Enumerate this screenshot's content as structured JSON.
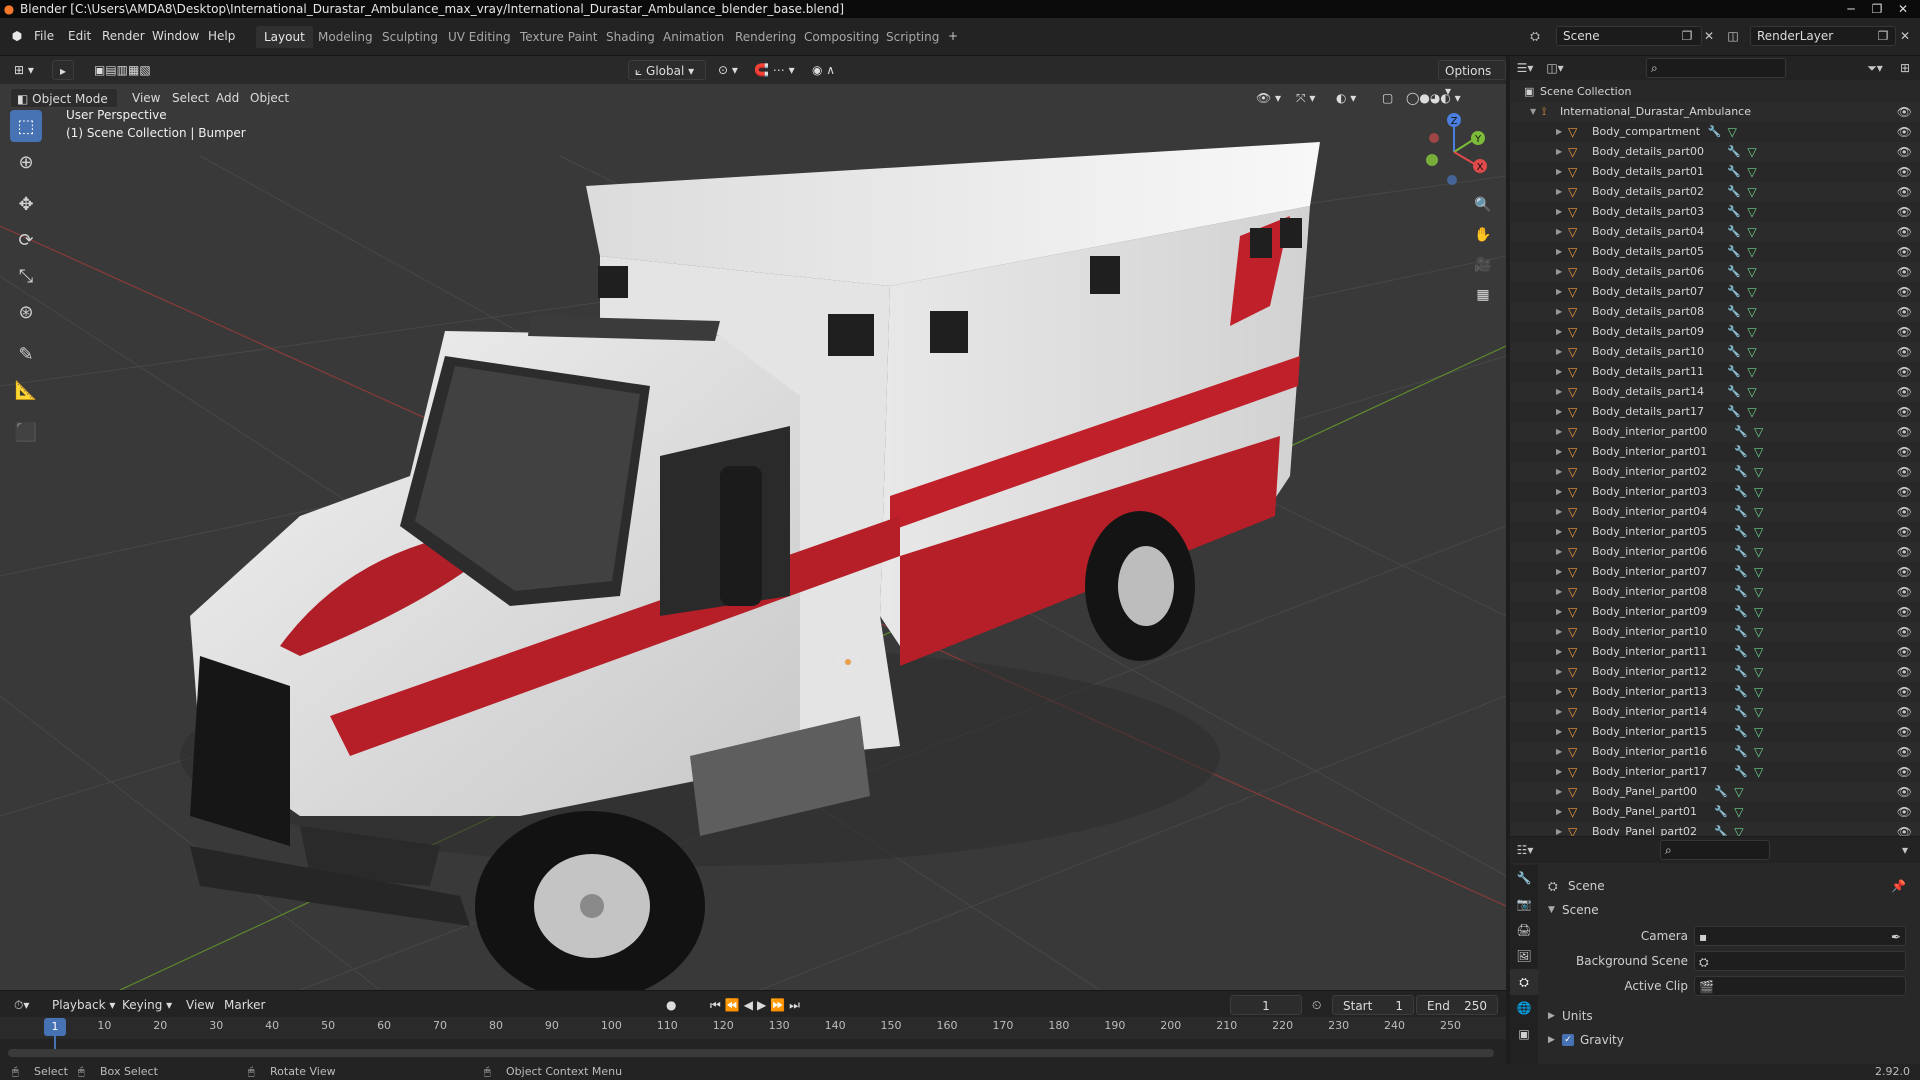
{
  "window": {
    "title": "Blender [C:\\Users\\AMDA8\\Desktop\\International_Durastar_Ambulance_max_vray/International_Durastar_Ambulance_blender_base.blend]"
  },
  "menu": [
    "File",
    "Edit",
    "Render",
    "Window",
    "Help"
  ],
  "workspaces": [
    {
      "label": "Layout",
      "active": true
    },
    {
      "label": "Modeling",
      "active": false
    },
    {
      "label": "Sculpting",
      "active": false
    },
    {
      "label": "UV Editing",
      "active": false
    },
    {
      "label": "Texture Paint",
      "active": false
    },
    {
      "label": "Shading",
      "active": false
    },
    {
      "label": "Animation",
      "active": false
    },
    {
      "label": "Rendering",
      "active": false
    },
    {
      "label": "Compositing",
      "active": false
    },
    {
      "label": "Scripting",
      "active": false
    }
  ],
  "scene_field": "Scene",
  "render_layer_field": "RenderLayer",
  "viewport": {
    "transform_orientation": "Global",
    "options_label": "Options",
    "mode": "Object Mode",
    "header_menus": [
      "View",
      "Select",
      "Add",
      "Object"
    ],
    "perspective_label": "User Perspective",
    "collection_label": "(1) Scene Collection | Bumper",
    "gizmo_axes": {
      "x": "X",
      "y": "Y",
      "z": "Z"
    }
  },
  "outliner": {
    "root": "Scene Collection",
    "collection": "International_Durastar_Ambulance",
    "items": [
      "Body_compartment",
      "Body_details_part00",
      "Body_details_part01",
      "Body_details_part02",
      "Body_details_part03",
      "Body_details_part04",
      "Body_details_part05",
      "Body_details_part06",
      "Body_details_part07",
      "Body_details_part08",
      "Body_details_part09",
      "Body_details_part10",
      "Body_details_part11",
      "Body_details_part14",
      "Body_details_part17",
      "Body_interior_part00",
      "Body_interior_part01",
      "Body_interior_part02",
      "Body_interior_part03",
      "Body_interior_part04",
      "Body_interior_part05",
      "Body_interior_part06",
      "Body_interior_part07",
      "Body_interior_part08",
      "Body_interior_part09",
      "Body_interior_part10",
      "Body_interior_part11",
      "Body_interior_part12",
      "Body_interior_part13",
      "Body_interior_part14",
      "Body_interior_part15",
      "Body_interior_part16",
      "Body_interior_part17",
      "Body_Panel_part00",
      "Body_Panel_part01",
      "Body_Panel_part02"
    ]
  },
  "properties": {
    "context": "Scene",
    "panel_title": "Scene",
    "camera_label": "Camera",
    "background_scene_label": "Background Scene",
    "active_clip_label": "Active Clip",
    "units_label": "Units",
    "gravity_label": "Gravity",
    "gravity_checked": true
  },
  "timeline": {
    "menus": [
      "Playback",
      "Keying",
      "View",
      "Marker"
    ],
    "current_frame": "1",
    "start_label": "Start",
    "start_value": "1",
    "end_label": "End",
    "end_value": "250",
    "ticks": [
      "1",
      "10",
      "20",
      "30",
      "40",
      "50",
      "60",
      "70",
      "80",
      "90",
      "100",
      "110",
      "120",
      "130",
      "140",
      "150",
      "160",
      "170",
      "180",
      "190",
      "200",
      "210",
      "220",
      "230",
      "240",
      "250"
    ]
  },
  "statusbar": {
    "select": "Select",
    "box_select": "Box Select",
    "rotate_view": "Rotate View",
    "context_menu": "Object Context Menu",
    "version": "2.92.0"
  },
  "colors": {
    "accent": "#4772b3",
    "object_orange": "#f49b3c",
    "mesh_green": "#6fd48c",
    "modifier_blue": "#6ea6ff",
    "ambulance_red": "#c0202a"
  }
}
